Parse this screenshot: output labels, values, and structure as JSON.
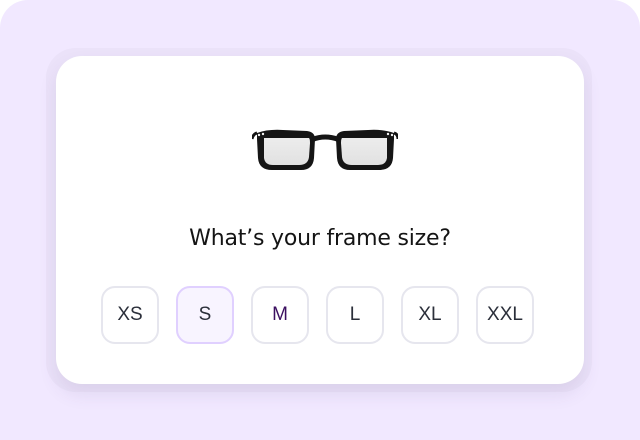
{
  "colors": {
    "outer_bg": "#f1e8ff",
    "card_bg": "#ffffff",
    "border": "#e6e6ee",
    "selected_border": "#e0d0ff",
    "selected_bg": "#f8f4ff",
    "focus_text": "#3b0f60"
  },
  "card": {
    "icon": "glasses-icon",
    "question": "What’s your frame size?"
  },
  "sizes": [
    {
      "label": "XS",
      "state": "default"
    },
    {
      "label": "S",
      "state": "selected"
    },
    {
      "label": "M",
      "state": "focus"
    },
    {
      "label": "L",
      "state": "default"
    },
    {
      "label": "XL",
      "state": "default"
    },
    {
      "label": "XXL",
      "state": "default"
    }
  ]
}
